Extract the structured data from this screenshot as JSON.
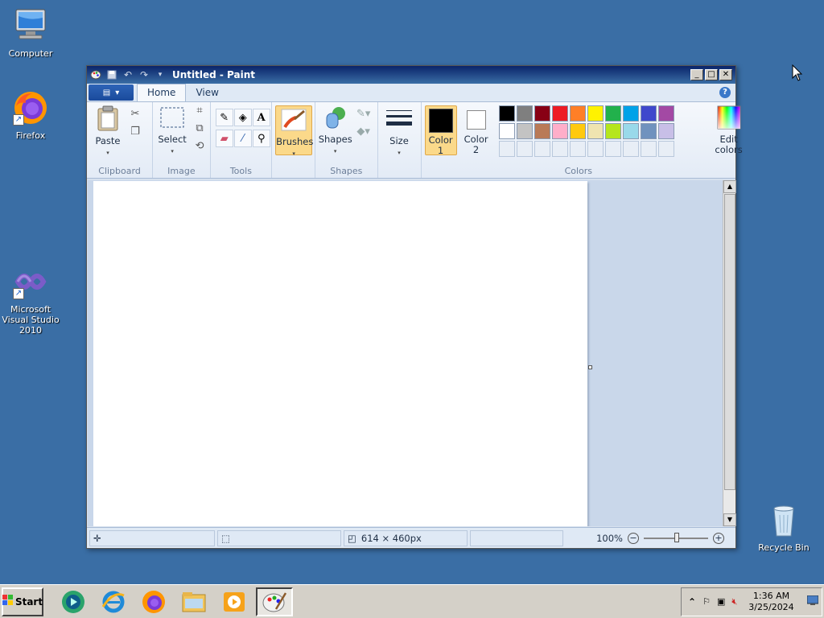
{
  "desktop": {
    "icons": [
      {
        "label": "Computer"
      },
      {
        "label": "Firefox"
      },
      {
        "label": "Microsoft Visual Studio 2010"
      },
      {
        "label": "Recycle Bin"
      }
    ]
  },
  "window": {
    "title": "Untitled - Paint",
    "tabs": [
      {
        "label": "Home"
      },
      {
        "label": "View"
      }
    ],
    "help_icon": "?",
    "ribbon": {
      "clipboard": {
        "group": "Clipboard",
        "paste": "Paste"
      },
      "image": {
        "group": "Image",
        "select": "Select"
      },
      "tools": {
        "group": "Tools"
      },
      "brushes": {
        "label": "Brushes"
      },
      "shapes": {
        "group": "Shapes",
        "label": "Shapes"
      },
      "size": {
        "label": "Size"
      },
      "colors": {
        "group": "Colors",
        "color1": "Color\n1",
        "color1_line1": "Color",
        "color1_line2": "1",
        "color2_line1": "Color",
        "color2_line2": "2",
        "edit_line1": "Edit",
        "edit_line2": "colors",
        "color1_value": "#000000",
        "color2_value": "#ffffff",
        "palette_row1": [
          "#000000",
          "#7f7f7f",
          "#880015",
          "#ed1c24",
          "#ff7f27",
          "#fff200",
          "#22b14c",
          "#00a2e8",
          "#3f48cc",
          "#a349a4"
        ],
        "palette_row2": [
          "#ffffff",
          "#c3c3c3",
          "#b97a57",
          "#ffaec9",
          "#ffc90e",
          "#efe4b0",
          "#b5e61d",
          "#99d9ea",
          "#7092be",
          "#c8bfe7"
        ]
      }
    },
    "statusbar": {
      "canvas_size": "614 × 460px",
      "zoom": "100%"
    }
  },
  "taskbar": {
    "start": "Start",
    "clock_time": "1:36 AM",
    "clock_date": "3/25/2024"
  }
}
